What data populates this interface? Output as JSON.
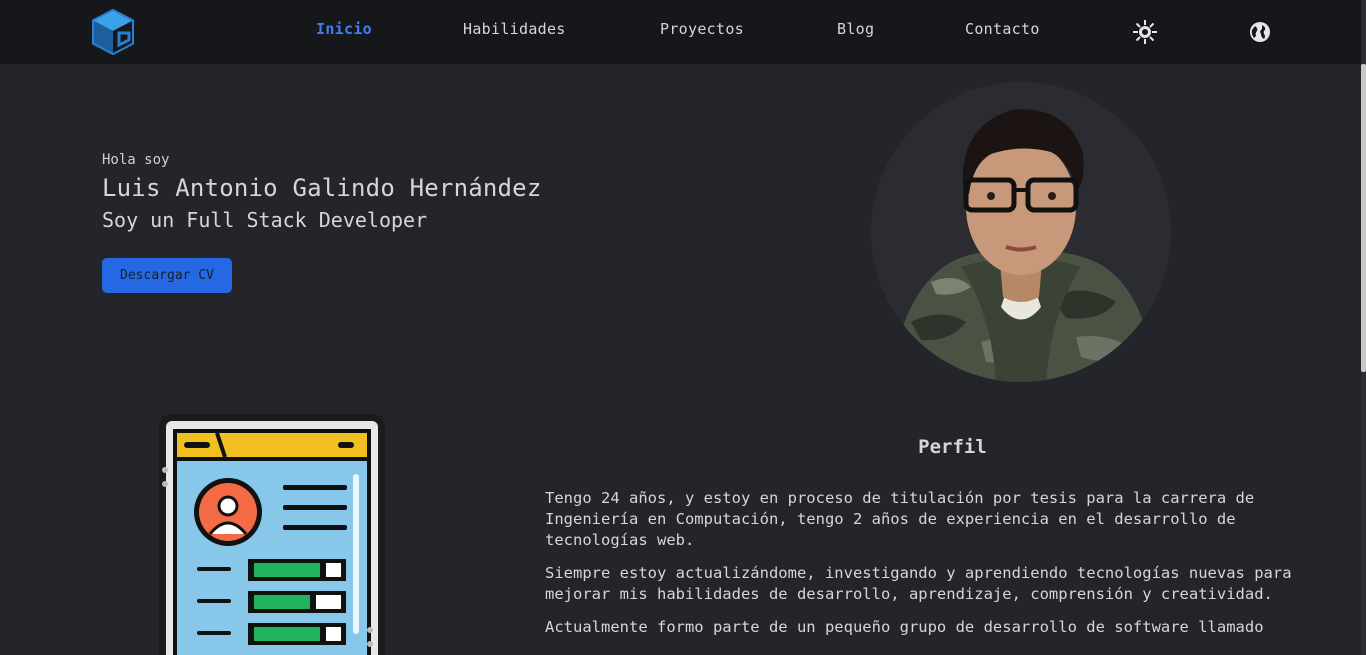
{
  "nav": {
    "links": [
      {
        "label": "Inicio",
        "active": true
      },
      {
        "label": "Habilidades"
      },
      {
        "label": "Proyectos"
      },
      {
        "label": "Blog"
      },
      {
        "label": "Contacto"
      }
    ],
    "theme_icon": "sun-icon",
    "language_icon": "globe-icon",
    "active_color": "#3f7ef5"
  },
  "hero": {
    "greeting": "Hola soy",
    "name": "Luis Antonio Galindo Hernández",
    "role": "Soy un Full Stack Developer",
    "cv_button": "Descargar CV",
    "button_color": "#2468e4"
  },
  "profile": {
    "title": "Perfil",
    "paragraphs": [
      "Tengo 24 años, y estoy en proceso de titulación por tesis para la carrera de Ingeniería en Computación, tengo 2 años de experiencia en el desarrollo de tecnologías web.",
      "Siempre estoy actualizándome, investigando y aprendiendo tecnologías nuevas para mejorar mis habilidades de desarrollo, aprendizaje, comprensión y creatividad.",
      "Actualmente formo parte de un pequeño grupo de desarrollo de software llamado"
    ]
  },
  "colors": {
    "background": "#23252b",
    "navbar": "#16171b"
  }
}
